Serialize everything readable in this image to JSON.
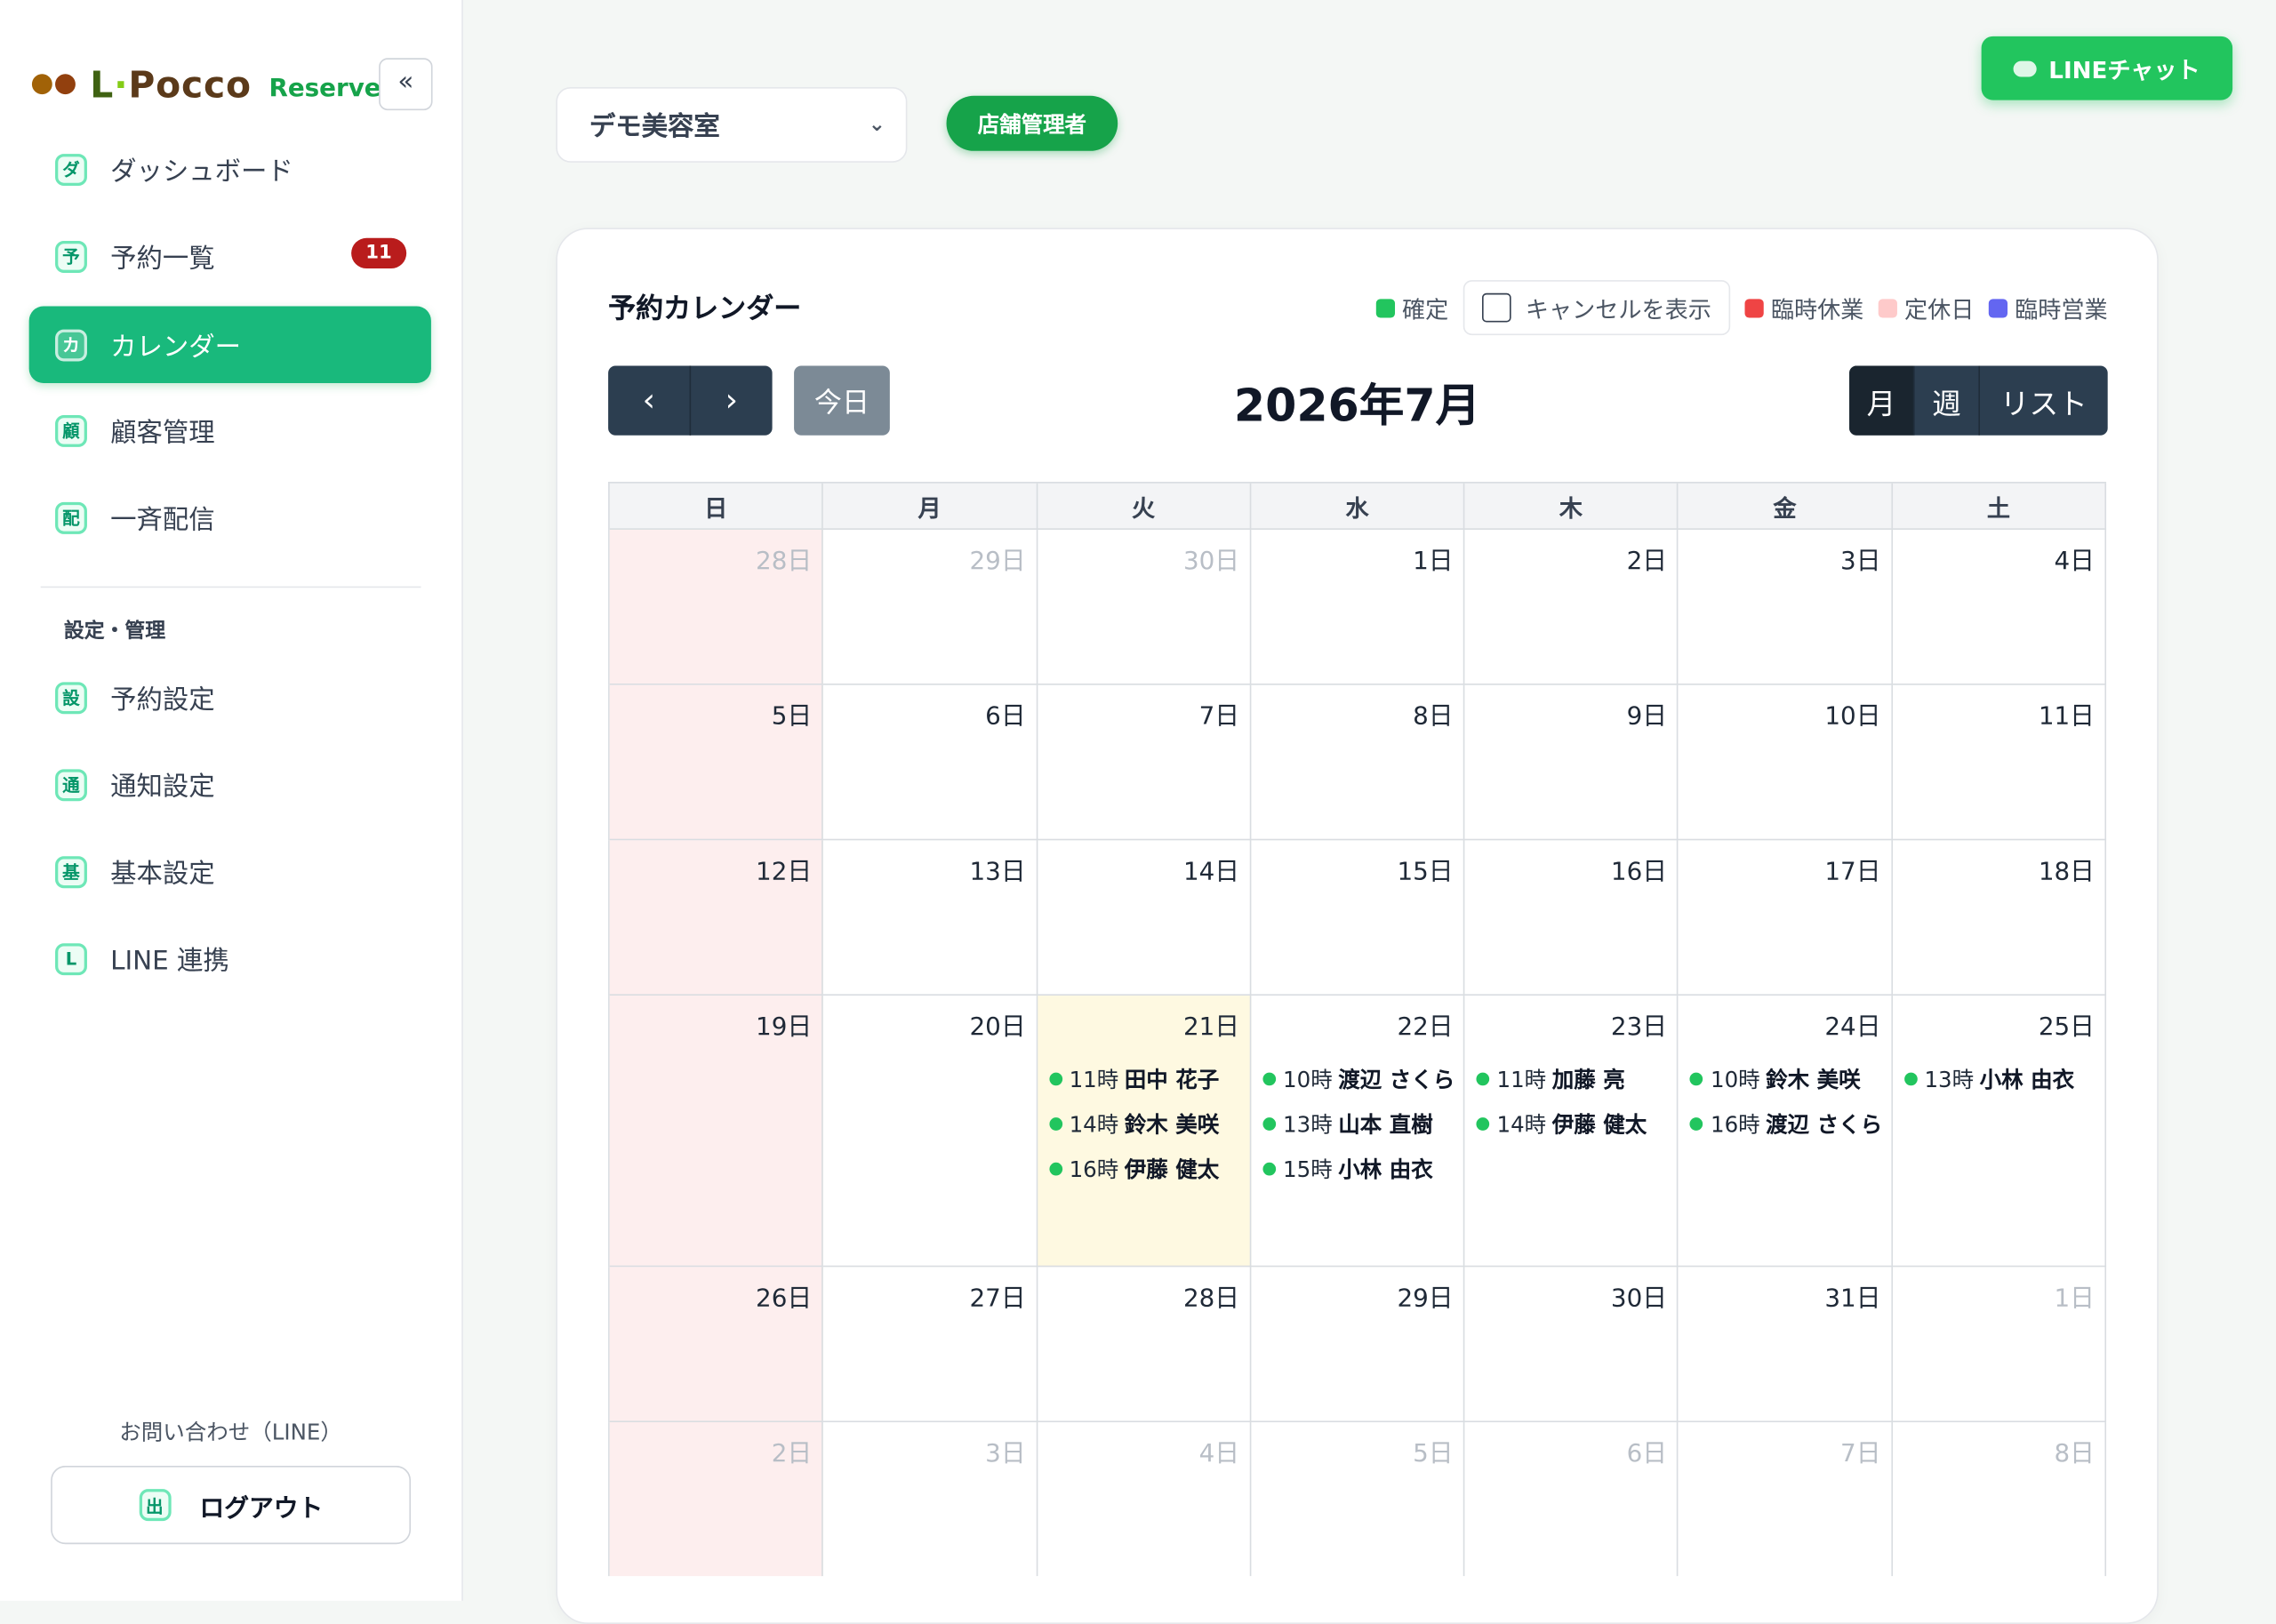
{
  "brand": {
    "l": "L",
    "pocco": "Pocco",
    "sub": "Reserve",
    "collapse": "«"
  },
  "sidebar": {
    "items": [
      {
        "icon": "ダ",
        "label": "ダッシュボード"
      },
      {
        "icon": "予",
        "label": "予約一覧",
        "badge": "11"
      },
      {
        "icon": "カ",
        "label": "カレンダー"
      },
      {
        "icon": "顧",
        "label": "顧客管理"
      },
      {
        "icon": "配",
        "label": "一斉配信"
      }
    ],
    "section_label": "設定・管理",
    "settings_items": [
      {
        "icon": "設",
        "label": "予約設定"
      },
      {
        "icon": "通",
        "label": "通知設定"
      },
      {
        "icon": "基",
        "label": "基本設定"
      },
      {
        "icon": "L",
        "label": "LINE 連携"
      }
    ],
    "contact": "お問い合わせ（LINE）",
    "logout_icon": "出",
    "logout": "ログアウト"
  },
  "topbar": {
    "store": "デモ美容室",
    "role": "店舗管理者",
    "line_chat": "LINEチャット"
  },
  "calendar": {
    "title": "予約カレンダー",
    "legend": {
      "confirmed": "確定",
      "show_cancel": "キャンセルを表示",
      "temp_closed": "臨時休業",
      "regular_holiday": "定休日",
      "temp_open": "臨時営業"
    },
    "prev": "‹",
    "next": "›",
    "today": "今日",
    "month_title": "2026年7月",
    "views": [
      "月",
      "週",
      "リスト"
    ],
    "weekdays": [
      "日",
      "月",
      "火",
      "水",
      "木",
      "金",
      "土"
    ],
    "colors": {
      "confirmed": "#22c55e",
      "temp_closed": "#ef4444",
      "regular_holiday": "#fecaca",
      "temp_open": "#6366f1",
      "accent": "#19b97c"
    },
    "weeks": [
      [
        "28日",
        "29日",
        "30日",
        "1日",
        "2日",
        "3日",
        "4日"
      ],
      [
        "5日",
        "6日",
        "7日",
        "8日",
        "9日",
        "10日",
        "11日"
      ],
      [
        "12日",
        "13日",
        "14日",
        "15日",
        "16日",
        "17日",
        "18日"
      ],
      [
        "19日",
        "20日",
        "21日",
        "22日",
        "23日",
        "24日",
        "25日"
      ],
      [
        "26日",
        "27日",
        "28日",
        "29日",
        "30日",
        "31日",
        "1日"
      ],
      [
        "2日",
        "3日",
        "4日",
        "5日",
        "6日",
        "7日",
        "8日"
      ]
    ],
    "events": {
      "tue21": [
        {
          "time": "11時",
          "name": "田中 花子"
        },
        {
          "time": "14時",
          "name": "鈴木 美咲"
        },
        {
          "time": "16時",
          "name": "伊藤 健太"
        }
      ],
      "wed22": [
        {
          "time": "10時",
          "name": "渡辺 さくら"
        },
        {
          "time": "13時",
          "name": "山本 直樹"
        },
        {
          "time": "15時",
          "name": "小林 由衣"
        }
      ],
      "thu23": [
        {
          "time": "11時",
          "name": "加藤 亮"
        },
        {
          "time": "14時",
          "name": "伊藤 健太"
        }
      ],
      "fri24": [
        {
          "time": "10時",
          "name": "鈴木 美咲"
        },
        {
          "time": "16時",
          "name": "渡辺 さくら"
        }
      ],
      "sat25": [
        {
          "time": "13時",
          "name": "小林 由衣"
        }
      ]
    }
  }
}
